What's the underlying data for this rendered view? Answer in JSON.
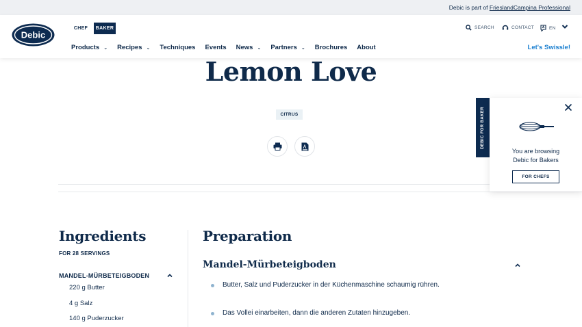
{
  "topbar": {
    "prefix": "Debic is part of",
    "link": "FrieslandCampina Professional"
  },
  "brand": {
    "logo_text": "Debic",
    "color_primary": "#0d2b50",
    "color_link": "#1a7fd0"
  },
  "segments": {
    "chef": "CHEF",
    "baker": "BAKER",
    "active": "BAKER"
  },
  "utility": {
    "search": "SEARCH",
    "contact": "CONTACT",
    "language": "EN"
  },
  "nav": {
    "items": [
      {
        "label": "Products",
        "has_dropdown": true
      },
      {
        "label": "Recipes",
        "has_dropdown": true
      },
      {
        "label": "Techniques",
        "has_dropdown": false
      },
      {
        "label": "Events",
        "has_dropdown": false
      },
      {
        "label": "News",
        "has_dropdown": true
      },
      {
        "label": "Partners",
        "has_dropdown": true
      },
      {
        "label": "Brochures",
        "has_dropdown": false
      },
      {
        "label": "About",
        "has_dropdown": false
      }
    ],
    "cta": "Let's Swissle!"
  },
  "recipe": {
    "title": "Lemon Love",
    "tag": "CITRUS"
  },
  "side_popup": {
    "tab_label": "DEBIC FOR BAKER",
    "message_line1": "You are browsing",
    "message_line2": "Debic for Bakers",
    "button": "FOR CHEFS"
  },
  "ingredients": {
    "title": "Ingredients",
    "servings": "FOR 28 SERVINGS",
    "group": "MANDEL-MÜRBETEIGBODEN",
    "items": [
      "220 g Butter",
      "4 g Salz",
      "140 g Puderzucker"
    ]
  },
  "preparation": {
    "title": "Preparation",
    "subtitle": "Mandel-Mürbeteigboden",
    "steps": [
      "Butter, Salz und Puderzucker in der Küchenmaschine schaumig rühren.",
      "Das Vollei einarbeiten, dann die anderen Zutaten hinzugeben."
    ]
  }
}
